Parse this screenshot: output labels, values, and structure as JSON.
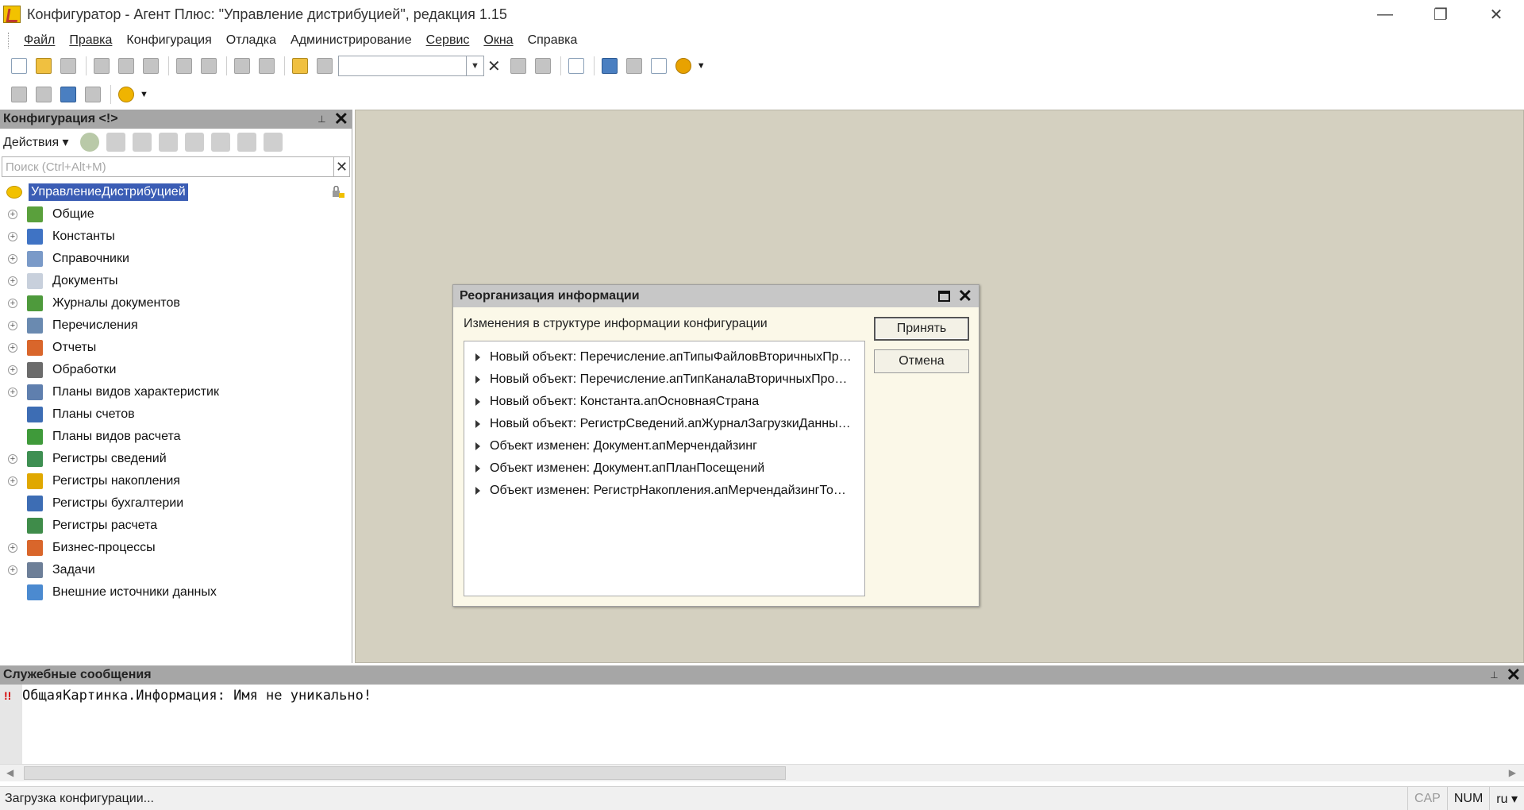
{
  "window": {
    "title": "Конфигуратор - Агент Плюс: \"Управление дистрибуцией\", редакция 1.15",
    "minimize": "—",
    "restore": "❐",
    "close": "✕"
  },
  "menu": [
    "Файл",
    "Правка",
    "Конфигурация",
    "Отладка",
    "Администрирование",
    "Сервис",
    "Окна",
    "Справка"
  ],
  "config_panel": {
    "title": "Конфигурация <!>",
    "actions_label": "Действия ▾",
    "search_placeholder": "Поиск (Ctrl+Alt+M)",
    "root": "УправлениеДистрибуцией",
    "items": [
      {
        "label": "Общие",
        "expandable": true,
        "icon": "common-icon",
        "color": "#5aa03c"
      },
      {
        "label": "Константы",
        "expandable": true,
        "icon": "constants-icon",
        "color": "#3f73c4"
      },
      {
        "label": "Справочники",
        "expandable": true,
        "icon": "catalogs-icon",
        "color": "#7a9ac8"
      },
      {
        "label": "Документы",
        "expandable": true,
        "icon": "documents-icon",
        "color": "#c8d0dc"
      },
      {
        "label": "Журналы документов",
        "expandable": true,
        "icon": "journals-icon",
        "color": "#4e9a3c"
      },
      {
        "label": "Перечисления",
        "expandable": true,
        "icon": "enums-icon",
        "color": "#6a8ab0"
      },
      {
        "label": "Отчеты",
        "expandable": true,
        "icon": "reports-icon",
        "color": "#d9662b"
      },
      {
        "label": "Обработки",
        "expandable": true,
        "icon": "processing-icon",
        "color": "#6b6b6b"
      },
      {
        "label": "Планы видов характеристик",
        "expandable": true,
        "icon": "char-plans-icon",
        "color": "#5f7fae"
      },
      {
        "label": "Планы счетов",
        "expandable": false,
        "icon": "accounts-icon",
        "color": "#3d6db4"
      },
      {
        "label": "Планы видов расчета",
        "expandable": false,
        "icon": "calc-plans-icon",
        "color": "#3f9a3a"
      },
      {
        "label": "Регистры сведений",
        "expandable": true,
        "icon": "info-registers-icon",
        "color": "#3e8f52"
      },
      {
        "label": "Регистры накопления",
        "expandable": true,
        "icon": "accum-registers-icon",
        "color": "#e0a800"
      },
      {
        "label": "Регистры бухгалтерии",
        "expandable": false,
        "icon": "accounting-registers-icon",
        "color": "#3d6db4"
      },
      {
        "label": "Регистры расчета",
        "expandable": false,
        "icon": "calc-registers-icon",
        "color": "#3f8c4a"
      },
      {
        "label": "Бизнес-процессы",
        "expandable": true,
        "icon": "bp-icon",
        "color": "#d9662b"
      },
      {
        "label": "Задачи",
        "expandable": true,
        "icon": "tasks-icon",
        "color": "#6d7f98"
      },
      {
        "label": "Внешние источники данных",
        "expandable": false,
        "icon": "ext-sources-icon",
        "color": "#4b8ad0"
      }
    ]
  },
  "dialog": {
    "title": "Реорганизация информации",
    "caption": "Изменения в структуре информации конфигурации",
    "items": [
      "Новый объект: Перечисление.апТипыФайловВторичныхПр…",
      "Новый объект: Перечисление.апТипКаналаВторичныхПро…",
      "Новый объект: Константа.апОсновнаяСтрана",
      "Новый объект: РегистрСведений.апЖурналЗагрузкиДанны…",
      "Объект изменен: Документ.апМерчендайзинг",
      "Объект изменен: Документ.апПланПосещений",
      "Объект изменен: РегистрНакопления.апМерчендайзингТо…"
    ],
    "accept": "Принять",
    "cancel": "Отмена"
  },
  "messages": {
    "title": "Служебные сообщения",
    "mark": "!!",
    "lines": [
      "ОбщаяКартинка.Информация: Имя не уникально!"
    ]
  },
  "status": {
    "text": "Загрузка конфигурации...",
    "cap": "CAP",
    "num": "NUM",
    "lang": "ru ▾"
  }
}
